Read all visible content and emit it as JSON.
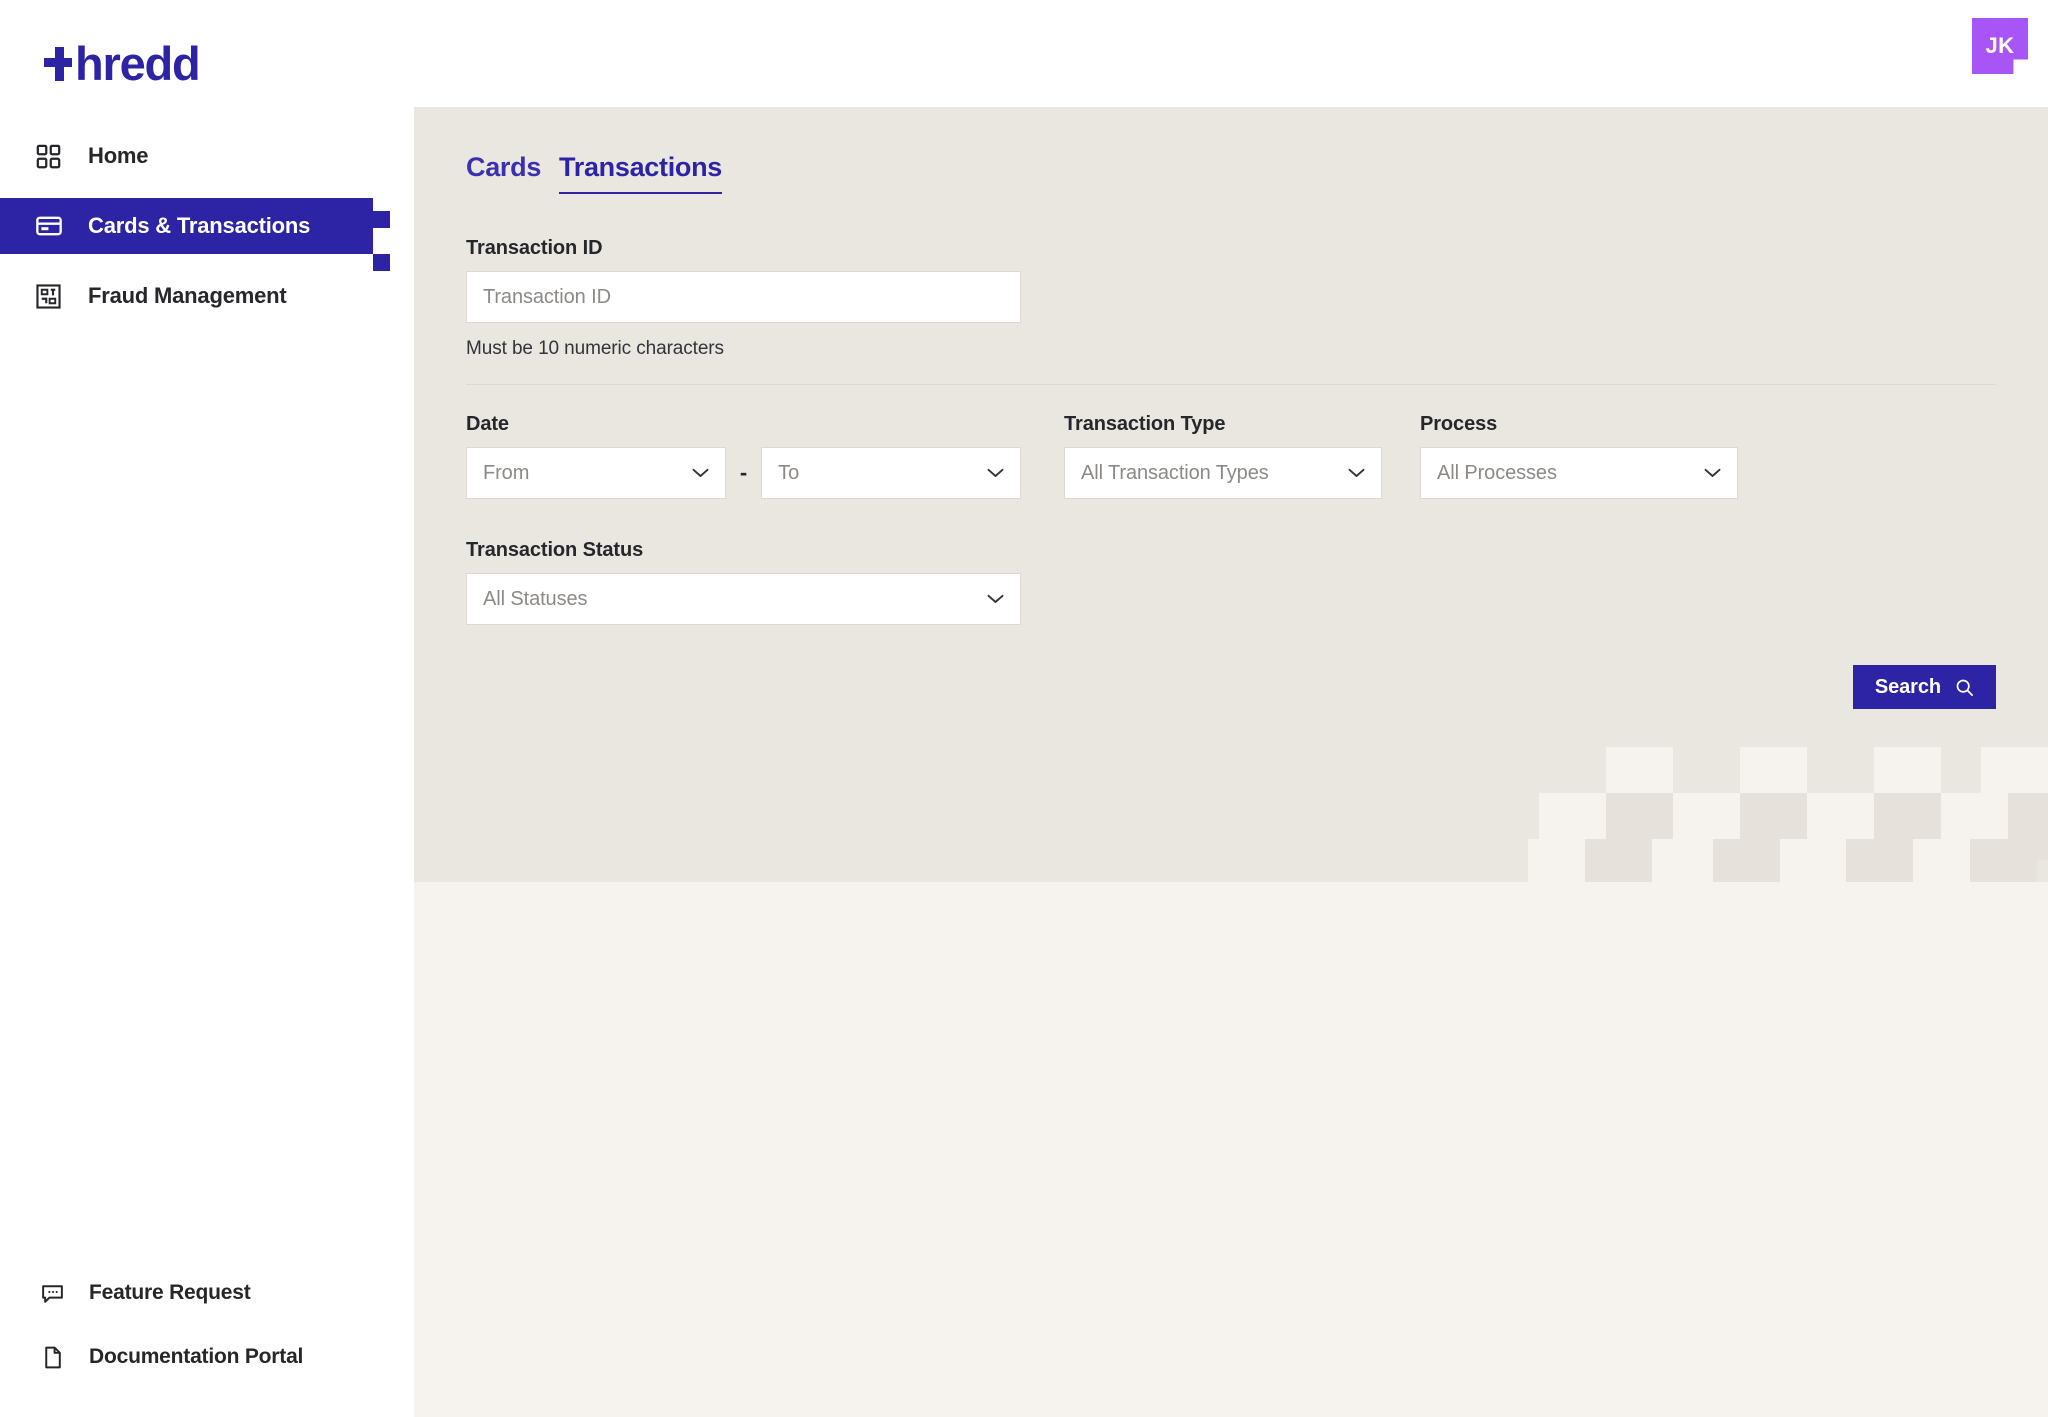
{
  "brand": {
    "logo_text": "hredd",
    "logo_icon": "plus-t-mark",
    "accent_color": "#2d23a5",
    "avatar_color": "#a855f7"
  },
  "account": {
    "avatar_initials": "JK",
    "avatar_icon": "user-avatar"
  },
  "sidebar": {
    "items": [
      {
        "label": "Home",
        "icon": "grid-icon",
        "active": false
      },
      {
        "label": "Cards & Transactions",
        "icon": "credit-card-icon",
        "active": true
      },
      {
        "label": "Fraud Management",
        "icon": "fraud-shield-icon",
        "active": false
      }
    ],
    "bottom_items": [
      {
        "label": "Feature Request",
        "icon": "chat-bubble-icon"
      },
      {
        "label": "Documentation Portal",
        "icon": "document-icon"
      }
    ]
  },
  "main": {
    "tabs": [
      {
        "label": "Cards",
        "active": false
      },
      {
        "label": "Transactions",
        "active": true
      }
    ],
    "fields": {
      "transaction_id": {
        "label": "Transaction ID",
        "placeholder": "Transaction ID",
        "value": "",
        "helper": "Must be 10 numeric characters"
      },
      "date": {
        "label": "Date",
        "from_placeholder": "From",
        "from_value": "",
        "to_placeholder": "To",
        "to_value": "",
        "separator": "-"
      },
      "transaction_type": {
        "label": "Transaction Type",
        "placeholder": "All Transaction Types",
        "value": ""
      },
      "process": {
        "label": "Process",
        "placeholder": "All Processes",
        "value": ""
      },
      "transaction_status": {
        "label": "Transaction Status",
        "placeholder": "All Statuses",
        "value": ""
      }
    },
    "search_button": {
      "label": "Search",
      "icon": "search-icon"
    }
  }
}
